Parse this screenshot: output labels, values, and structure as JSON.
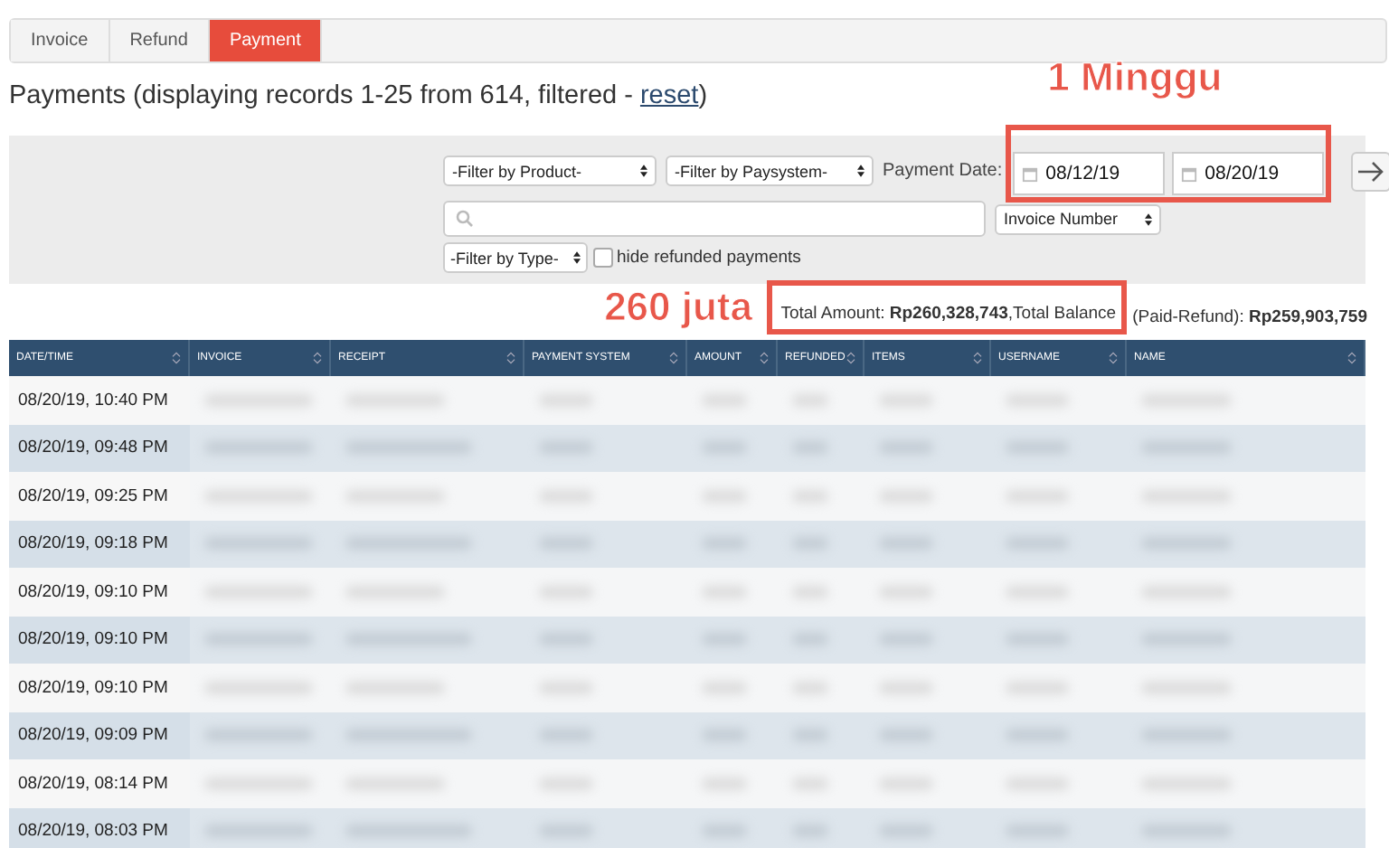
{
  "tabs": [
    {
      "label": "Invoice",
      "selected": false
    },
    {
      "label": "Refund",
      "selected": false
    },
    {
      "label": "Payment",
      "selected": true
    }
  ],
  "heading": {
    "text": "Payments (displaying records 1-25 from 614, filtered - ",
    "link": "reset",
    "close": ")"
  },
  "filters": {
    "product": "-Filter by Product-",
    "paysystem": "-Filter by Paysystem-",
    "date_label": "Payment Date:",
    "date_from": "08/12/19",
    "date_to": "08/20/19",
    "search_by": "Invoice Number",
    "type": "-Filter by Type-",
    "hide_refunded": {
      "label": "hide refunded payments",
      "checked": false
    }
  },
  "annotations": {
    "date_note": "1 Minggu",
    "total_note": "260 juta"
  },
  "summary": {
    "total": "Total Amount: **Rp260,328,743**,Total Balance",
    "balance": "(Paid-Refund): **Rp259,903,759**"
  },
  "table": {
    "columns": [
      "DATE/TIME",
      "INVOICE",
      "RECEIPT",
      "PAYMENT SYSTEM",
      "AMOUNT",
      "REFUNDED",
      "ITEMS",
      "USERNAME",
      "NAME"
    ],
    "rows": [
      {
        "datetime": "08/20/19, 10:40 PM"
      },
      {
        "datetime": "08/20/19, 09:48 PM"
      },
      {
        "datetime": "08/20/19, 09:25 PM"
      },
      {
        "datetime": "08/20/19, 09:18 PM"
      },
      {
        "datetime": "08/20/19, 09:10 PM"
      },
      {
        "datetime": "08/20/19, 09:10 PM"
      },
      {
        "datetime": "08/20/19, 09:10 PM"
      },
      {
        "datetime": "08/20/19, 09:09 PM"
      },
      {
        "datetime": "08/20/19, 08:14 PM"
      },
      {
        "datetime": "08/20/19, 08:03 PM"
      }
    ]
  }
}
